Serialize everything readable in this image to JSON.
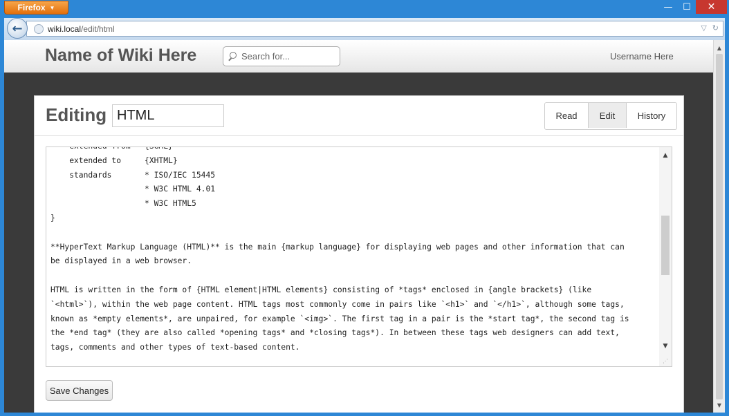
{
  "browser": {
    "menu_label": "Firefox",
    "url_host": "wiki.local",
    "url_path": "/edit/html",
    "window_controls": {
      "minimize": "—",
      "maximize": "☐",
      "close": "✕"
    }
  },
  "site": {
    "title": "Name of Wiki Here",
    "search_placeholder": "Search for...",
    "username": "Username Here"
  },
  "editor": {
    "heading": "Editing",
    "page_title": "HTML",
    "tabs": [
      {
        "label": "Read"
      },
      {
        "label": "Edit",
        "active": true
      },
      {
        "label": "History"
      }
    ],
    "content": "    extended from   {SGML}\n    extended to     {XHTML}\n    standards       * ISO/IEC 15445\n                    * W3C HTML 4.01\n                    * W3C HTML5\n}\n\n**HyperText Markup Language (HTML)** is the main {markup language} for displaying web pages and other information that can\nbe displayed in a web browser.\n\nHTML is written in the form of {HTML element|HTML elements} consisting of *tags* enclosed in {angle brackets} (like\n`<html>`), within the web page content. HTML tags most commonly come in pairs like `<h1>` and `</h1>`, although some tags,\nknown as *empty elements*, are unpaired, for example `<img>`. The first tag in a pair is the *start tag*, the second tag is\nthe *end tag* (they are also called *opening tags* and *closing tags*). In between these tags web designers can add text,\ntags, comments and other types of text-based content.",
    "save_label": "Save Changes"
  },
  "colors": {
    "page_background": "#3a3a3a",
    "window_frame": "#2d87d6",
    "firefox_button": "#e8780f",
    "close_button": "#c7372f"
  }
}
